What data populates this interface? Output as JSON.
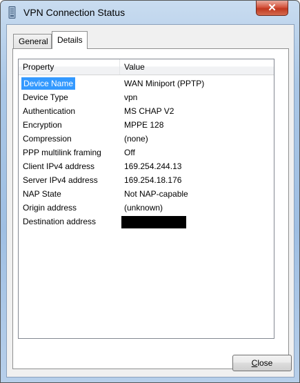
{
  "window": {
    "title": "VPN Connection Status",
    "close_glyph": "✕"
  },
  "tabs": [
    {
      "label": "General",
      "active": false
    },
    {
      "label": "Details",
      "active": true
    }
  ],
  "table": {
    "headers": {
      "property": "Property",
      "value": "Value"
    },
    "rows": [
      {
        "property": "Device Name",
        "value": "WAN Miniport (PPTP)",
        "selected": true
      },
      {
        "property": "Device Type",
        "value": "vpn"
      },
      {
        "property": "Authentication",
        "value": "MS CHAP V2"
      },
      {
        "property": "Encryption",
        "value": "MPPE 128"
      },
      {
        "property": "Compression",
        "value": "(none)"
      },
      {
        "property": "PPP multilink framing",
        "value": "Off"
      },
      {
        "property": "Client IPv4 address",
        "value": "169.254.244.13"
      },
      {
        "property": "Server IPv4 address",
        "value": "169.254.18.176"
      },
      {
        "property": "NAP State",
        "value": "Not NAP-capable"
      },
      {
        "property": "Origin address",
        "value": "(unknown)"
      },
      {
        "property": "Destination address",
        "value": "",
        "redacted": true
      }
    ]
  },
  "buttons": {
    "close_label": "Close",
    "close_access_key": "C"
  },
  "colors": {
    "selection": "#3399ff",
    "titlebar": "#aac7e6",
    "close_button": "#c0381f"
  }
}
